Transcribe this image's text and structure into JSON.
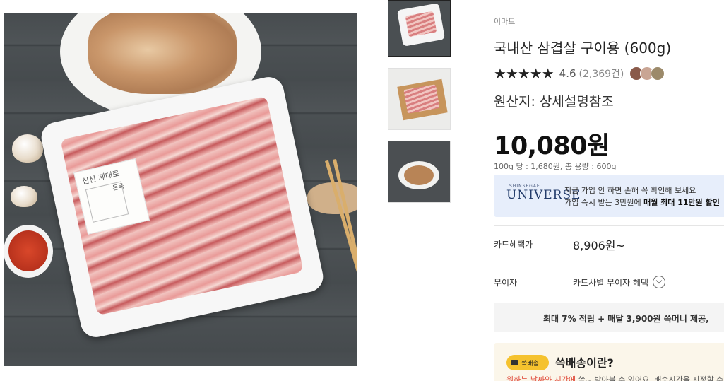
{
  "gallery": {
    "main_image": "pork-belly-tray-photo",
    "package_label": "신선 제대로",
    "package_tag": "돈육",
    "thumbnails": [
      "thumb-tray",
      "thumb-board",
      "thumb-plate"
    ]
  },
  "product": {
    "seller": "이마트",
    "title": "국내산 삼겹살 구이용 (600g)",
    "stars": "★★★★★",
    "rating": "4.6",
    "review_count": "(2,369건)",
    "origin": "원산지: 상세설명참조",
    "price": "10,080원",
    "unit_price": "100g 당 : 1,680원, 총 용량 : 600g"
  },
  "universe": {
    "small": "SHINSEGAE",
    "logo": "UNIVERSE",
    "line1": "지금 가입 안 하면 손해 꼭 확인해 보세요",
    "line2_prefix": "가입 즉시 받는 3만원에 ",
    "line2_bold": "매월 최대 11만원 할인"
  },
  "benefits": {
    "card_label": "카드혜택가",
    "card_price": "8,906원~",
    "installment_label": "무이자",
    "installment_value": "카드사별 무이자 혜택"
  },
  "reward": {
    "text": "최대 7% 적립 + 매달 3,900원 쓱머니 제공,"
  },
  "ssg_delivery": {
    "badge": "쓱배송",
    "title": "쓱배송이란?",
    "sub_highlight": "원하는 날짜와 시간에",
    "sub_rest": " 쓱~ 받아볼 수 있어요. 배송시간을 지정할 수"
  },
  "colors": {
    "universe_bg": "#e7eefb",
    "badge_yellow": "#f5c22e",
    "highlight_red": "#e04b3a"
  }
}
